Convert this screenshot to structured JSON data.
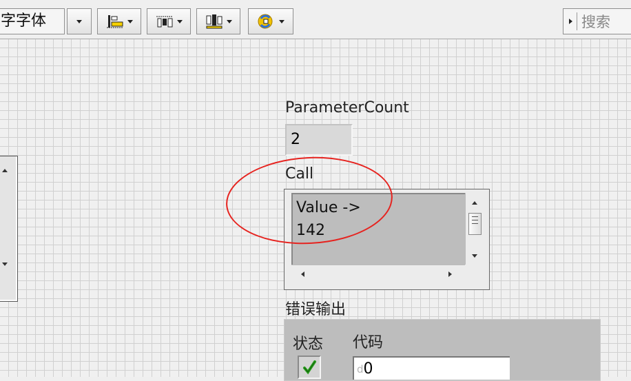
{
  "toolbar": {
    "font_selector": "字字体",
    "search_label": "搜索"
  },
  "controls": {
    "parameter_count": {
      "label": "ParameterCount",
      "value": "2"
    },
    "call": {
      "label": "Call",
      "value": "Value ->\n142"
    },
    "error_out": {
      "label": "错误输出",
      "status_label": "状态",
      "code_label": "代码",
      "code_prefix": "d",
      "code_value": "0"
    }
  },
  "colors": {
    "highlight": "#e6231f",
    "status_check": "#2a9d1e"
  },
  "icons": [
    "align-objects-icon",
    "distribute-objects-icon",
    "resize-objects-icon",
    "reorder-icon",
    "search-arrow-icon",
    "check-icon"
  ]
}
